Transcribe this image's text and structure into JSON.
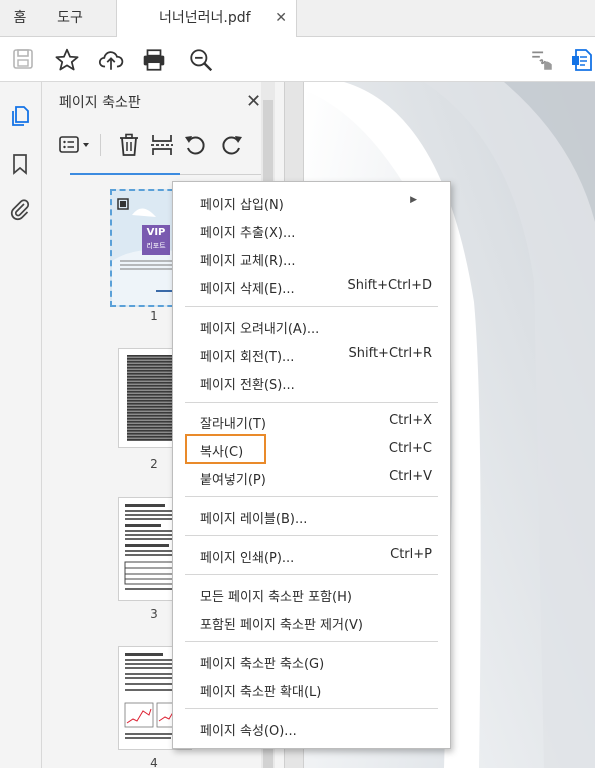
{
  "tabs": {
    "home": "홈",
    "tools": "도구",
    "document": "너너넌러너.pdf",
    "close": "✕"
  },
  "toolbar": {
    "save": "save-icon",
    "bookmark_star": "star-icon",
    "upload": "cloud-upload-icon",
    "print": "printer-icon",
    "zoom": "zoom-out-icon",
    "sign": "fill-sign-icon",
    "export": "export-pdf-icon"
  },
  "colors": {
    "accent": "#1473e6",
    "highlight": "#e98a2a",
    "selection": "#5aa0d8"
  },
  "panel": {
    "title": "페이지 축소판",
    "close": "✕"
  },
  "thumbnails": [
    {
      "page": "1",
      "cover_text": "VIP",
      "cover_sub": "리포트"
    },
    {
      "page": "2"
    },
    {
      "page": "3"
    },
    {
      "page": "4"
    }
  ],
  "menu": {
    "items": [
      {
        "label": "페이지 삽입(N)",
        "shortcut": "",
        "submenu": true
      },
      {
        "label": "페이지 추출(X)...",
        "shortcut": ""
      },
      {
        "label": "페이지 교체(R)...",
        "shortcut": ""
      },
      {
        "label": "페이지 삭제(E)...",
        "shortcut": "Shift+Ctrl+D"
      },
      {
        "label": "페이지 오려내기(A)...",
        "shortcut": ""
      },
      {
        "label": "페이지 회전(T)...",
        "shortcut": "Shift+Ctrl+R"
      },
      {
        "label": "페이지 전환(S)...",
        "shortcut": ""
      },
      {
        "label": "잘라내기(T)",
        "shortcut": "Ctrl+X"
      },
      {
        "label": "복사(C)",
        "shortcut": "Ctrl+C"
      },
      {
        "label": "붙여넣기(P)",
        "shortcut": "Ctrl+V"
      },
      {
        "label": "페이지 레이블(B)...",
        "shortcut": ""
      },
      {
        "label": "페이지 인쇄(P)...",
        "shortcut": "Ctrl+P"
      },
      {
        "label": "모든 페이지 축소판 포함(H)",
        "shortcut": ""
      },
      {
        "label": "포함된 페이지 축소판 제거(V)",
        "shortcut": ""
      },
      {
        "label": "페이지 축소판 축소(G)",
        "shortcut": ""
      },
      {
        "label": "페이지 축소판 확대(L)",
        "shortcut": ""
      },
      {
        "label": "페이지 속성(O)...",
        "shortcut": ""
      }
    ]
  }
}
